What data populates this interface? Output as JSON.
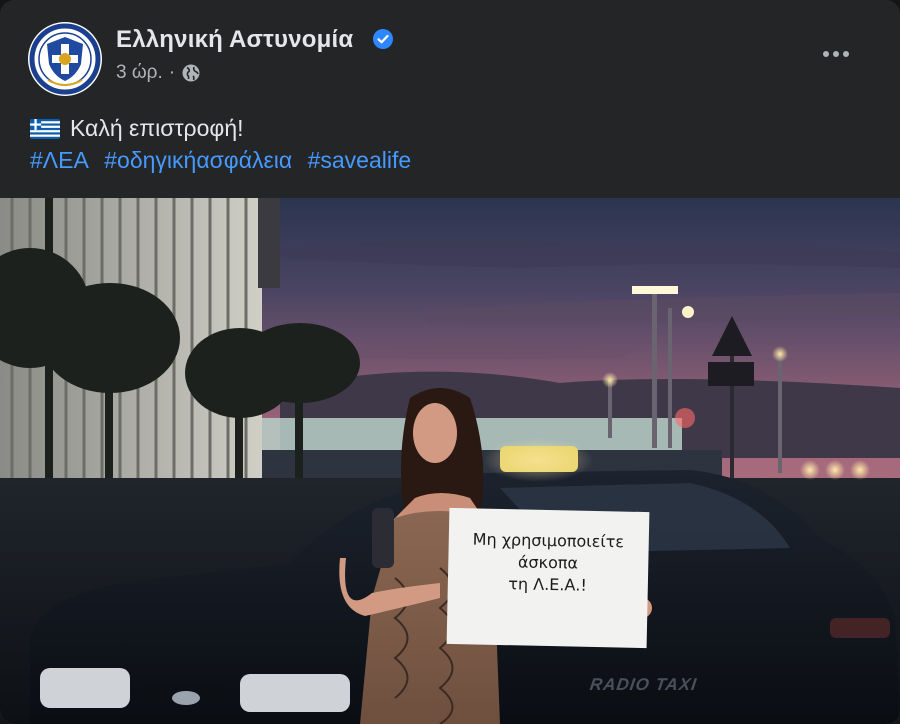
{
  "post": {
    "author_name": "Ελληνική Αστυνομία",
    "verified": true,
    "time_ago": "3 ώρ.",
    "separator": "·",
    "audience_icon": "globe-icon",
    "text": "Καλή επιστροφή!",
    "hashtags": [
      "#ΛΕΑ",
      "#οδηγικήασφάλεια",
      "#savealife"
    ]
  },
  "photo": {
    "sign_lines": [
      "Μη χρησιμοποιείτε",
      "άσκοπα",
      "τη Λ.Ε.Α.!"
    ],
    "taxi_door_text": "RADIO TAXI"
  },
  "colors": {
    "background": "#242526",
    "primary_text": "#e4e6eb",
    "secondary_text": "#b0b3b8",
    "hashtag": "#4599ff",
    "verified_badge": "#2d88ff"
  }
}
